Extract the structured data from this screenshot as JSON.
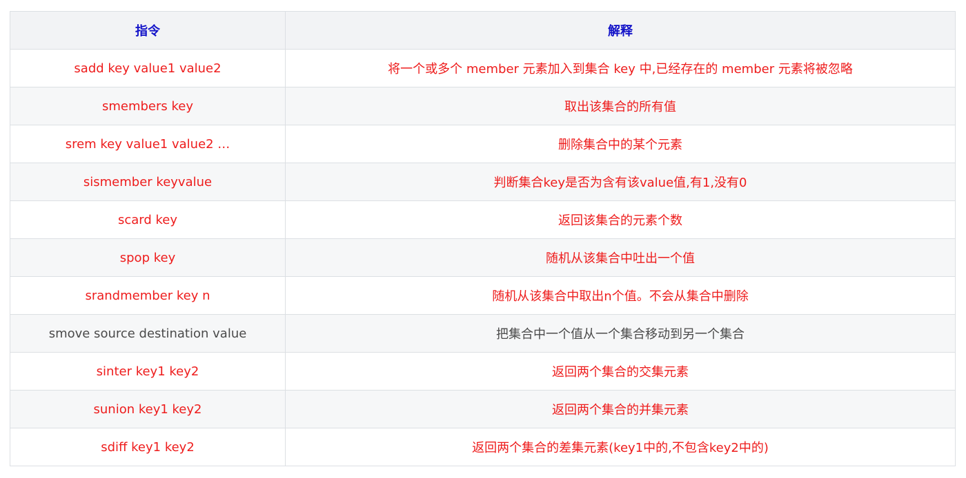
{
  "table": {
    "headers": [
      "指令",
      "解释"
    ],
    "rows": [
      {
        "command": "sadd key value1 value2",
        "description": "将一个或多个 member 元素加入到集合 key 中,已经存在的 member 元素将被忽略",
        "tone": "red"
      },
      {
        "command": "smembers key",
        "description": "取出该集合的所有值",
        "tone": "red"
      },
      {
        "command": "srem key value1 value2 …",
        "description": "删除集合中的某个元素",
        "tone": "red"
      },
      {
        "command": "sismember keyvalue",
        "description": "判断集合key是否为含有该value值,有1,没有0",
        "tone": "red"
      },
      {
        "command": "scard key",
        "description": "返回该集合的元素个数",
        "tone": "red"
      },
      {
        "command": "spop key",
        "description": "随机从该集合中吐出一个值",
        "tone": "red"
      },
      {
        "command": "srandmember key n",
        "description": "随机从该集合中取出n个值。不会从集合中删除",
        "tone": "red"
      },
      {
        "command": "smove source destination value",
        "description": "把集合中一个值从一个集合移动到另一个集合",
        "tone": "gray"
      },
      {
        "command": "sinter key1 key2",
        "description": "返回两个集合的交集元素",
        "tone": "red"
      },
      {
        "command": "sunion key1 key2",
        "description": "返回两个集合的并集元素",
        "tone": "red"
      },
      {
        "command": "sdiff key1 key2",
        "description": "返回两个集合的差集元素(key1中的,不包含key2中的)",
        "tone": "red"
      }
    ]
  },
  "colors": {
    "header_text": "#1212c8",
    "red_text": "#ee1c1c",
    "gray_text": "#4a4a4a",
    "header_bg": "#f2f3f5",
    "stripe_bg": "#f6f7f8",
    "border": "#dcdfe3"
  }
}
